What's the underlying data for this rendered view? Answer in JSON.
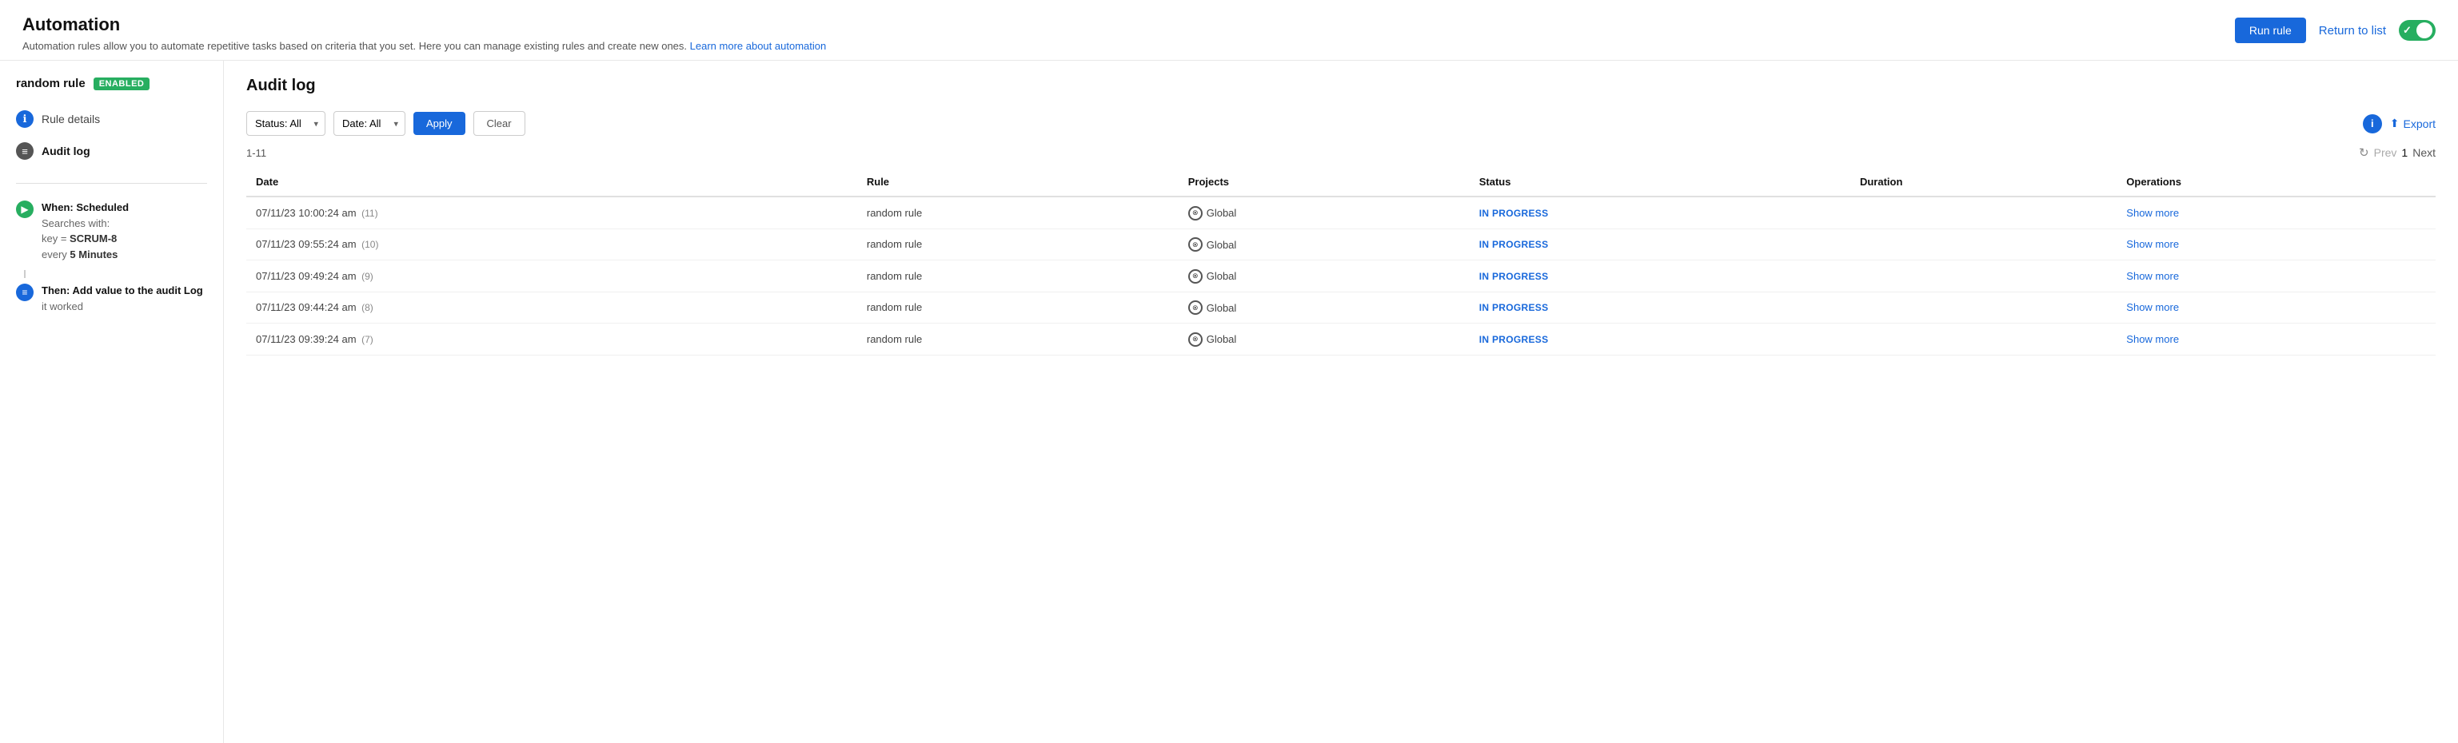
{
  "app": {
    "title": "Automation",
    "subtitle": "Automation rules allow you to automate repetitive tasks based on criteria that you set. Here you can manage existing rules and create new ones.",
    "subtitle_link": "Learn more about automation",
    "run_rule_label": "Run rule",
    "return_to_list_label": "Return to list"
  },
  "sidebar": {
    "rule_name": "random rule",
    "enabled_badge": "ENABLED",
    "nav_items": [
      {
        "id": "rule-details",
        "label": "Rule details",
        "icon": "ℹ",
        "icon_type": "info",
        "active": false
      },
      {
        "id": "audit-log",
        "label": "Audit log",
        "icon": "≡",
        "icon_type": "audit",
        "active": true
      }
    ],
    "when_section": {
      "title": "When: Scheduled",
      "detail1": "Searches with:",
      "detail2_prefix": "key = ",
      "detail2_value": "SCRUM-8",
      "detail3_prefix": "every ",
      "detail3_value": "5 Minutes"
    },
    "then_section": {
      "title": "Then: Add value to the audit Log",
      "detail": "it worked"
    }
  },
  "audit_log": {
    "title": "Audit log",
    "filters": {
      "status_label": "Status: All",
      "date_label": "Date: All",
      "apply_label": "Apply",
      "clear_label": "Clear"
    },
    "record_range": "1-11",
    "pagination": {
      "prev_label": "Prev",
      "page_number": "1",
      "next_label": "Next"
    },
    "export_label": "Export",
    "columns": [
      "Date",
      "Rule",
      "Projects",
      "Status",
      "Duration",
      "Operations"
    ],
    "rows": [
      {
        "date": "07/11/23 10:00:24 am",
        "count": "(11)",
        "rule": "random rule",
        "project": "Global",
        "status": "IN PROGRESS",
        "duration": "",
        "operations": "Show more"
      },
      {
        "date": "07/11/23 09:55:24 am",
        "count": "(10)",
        "rule": "random rule",
        "project": "Global",
        "status": "IN PROGRESS",
        "duration": "",
        "operations": "Show more"
      },
      {
        "date": "07/11/23 09:49:24 am",
        "count": "(9)",
        "rule": "random rule",
        "project": "Global",
        "status": "IN PROGRESS",
        "duration": "",
        "operations": "Show more"
      },
      {
        "date": "07/11/23 09:44:24 am",
        "count": "(8)",
        "rule": "random rule",
        "project": "Global",
        "status": "IN PROGRESS",
        "duration": "",
        "operations": "Show more"
      },
      {
        "date": "07/11/23 09:39:24 am",
        "count": "(7)",
        "rule": "random rule",
        "project": "Global",
        "status": "IN PROGRESS",
        "duration": "",
        "operations": "Show more"
      }
    ]
  }
}
